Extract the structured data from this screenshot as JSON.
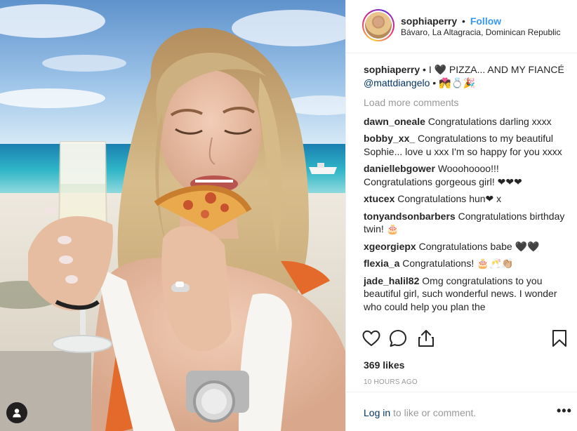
{
  "post": {
    "username": "sophiaperry",
    "separator": "•",
    "follow_label": "Follow",
    "location": "Bávaro, La Altagracia, Dominican Republic"
  },
  "caption": {
    "username": "sophiaperry",
    "text": "• I 🖤 PIZZA... AND MY FIANCÉ",
    "mention": "@mattdiangelo",
    "tail": "• 💏💍🎉"
  },
  "load_more": "Load more comments",
  "comments": [
    {
      "user": "dawn_oneale",
      "text": "Congratulations darling xxxx"
    },
    {
      "user": "bobby_xx_",
      "text": "Congratulations to my beautiful Sophie... love u xxx I'm so happy for you xxxx"
    },
    {
      "user": "daniellebgower",
      "text": "Wooohoooo!!! Congratulations gorgeous girl! ❤❤❤"
    },
    {
      "user": "xtucex",
      "text": "Congratulations hun❤ x"
    },
    {
      "user": "tonyandsonbarbers",
      "text": "Congratulations birthday twin! 🎂"
    },
    {
      "user": "xgeorgiepx",
      "text": "Congratulations babe 🖤🖤"
    },
    {
      "user": "flexia_a",
      "text": "Congratulations! 🎂🥂👏🏼"
    },
    {
      "user": "jade_halil82",
      "text": "Omg congratulations to you beautiful girl, such wonderful news. I wonder who could help you plan the"
    }
  ],
  "actions": {
    "like": "heart-icon",
    "comment": "comment-icon",
    "share": "share-icon",
    "save": "bookmark-icon"
  },
  "likes": "369 likes",
  "timestamp": "10 HOURS AGO",
  "footer": {
    "login_label": "Log in",
    "login_rest": " to like or comment.",
    "more_label": "•••"
  },
  "colors": {
    "link_blue": "#3897f0",
    "mention_navy": "#003569",
    "muted": "#999999",
    "text": "#262626",
    "border": "#efefef"
  }
}
